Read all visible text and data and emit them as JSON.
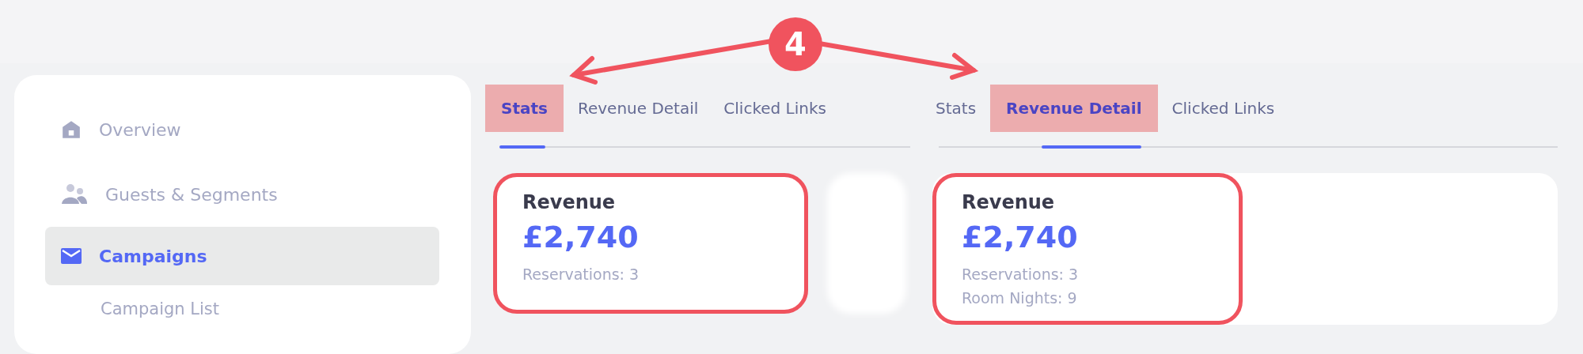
{
  "annotation": {
    "label": "4"
  },
  "sidebar": {
    "items": [
      {
        "label": "Overview",
        "selected": false
      },
      {
        "label": "Guests & Segments",
        "selected": false
      },
      {
        "label": "Campaigns",
        "selected": true,
        "children": [
          {
            "label": "Campaign List",
            "selected": false
          }
        ]
      }
    ]
  },
  "panels": [
    {
      "tabs": [
        {
          "label": "Stats",
          "selected": true,
          "highlighted": true
        },
        {
          "label": "Revenue Detail",
          "selected": false,
          "highlighted": false
        },
        {
          "label": "Clicked Links",
          "selected": false,
          "highlighted": false
        }
      ],
      "cards": [
        {
          "kind": "stat",
          "highlighted": true,
          "title": "Revenue",
          "value": "£2,740",
          "details": [
            "Reservations: 3"
          ]
        },
        {
          "kind": "blurred"
        }
      ]
    },
    {
      "tabs": [
        {
          "label": "Stats",
          "selected": false,
          "highlighted": false
        },
        {
          "label": "Revenue Detail",
          "selected": true,
          "highlighted": true
        },
        {
          "label": "Clicked Links",
          "selected": false,
          "highlighted": false
        }
      ],
      "cards": [
        {
          "kind": "stat",
          "highlighted": true,
          "title": "Revenue",
          "value": "£2,740",
          "details": [
            "Reservations: 3",
            "Room Nights: 9"
          ]
        }
      ]
    }
  ]
}
